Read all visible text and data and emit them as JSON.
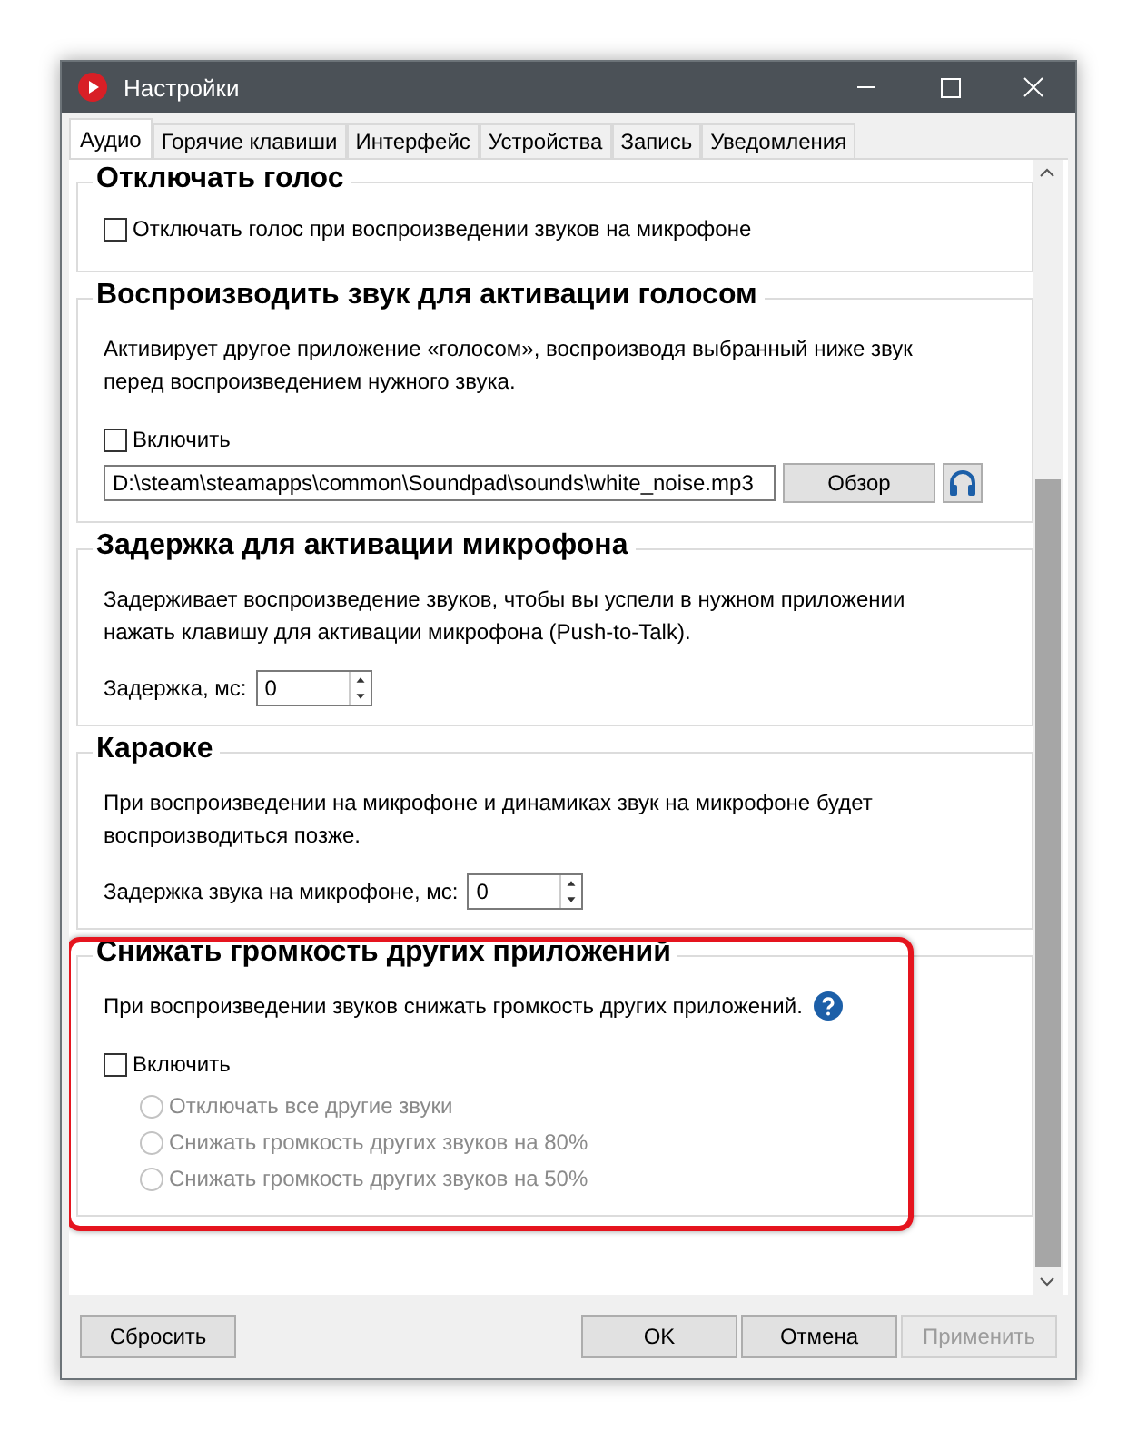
{
  "window": {
    "title": "Настройки"
  },
  "tabs": [
    {
      "label": "Аудио",
      "selected": true
    },
    {
      "label": "Горячие клавиши",
      "selected": false
    },
    {
      "label": "Интерфейс",
      "selected": false
    },
    {
      "label": "Устройства",
      "selected": false
    },
    {
      "label": "Запись",
      "selected": false
    },
    {
      "label": "Уведомления",
      "selected": false
    }
  ],
  "sections": [
    {
      "title": "Отключать голос",
      "highlighted": false,
      "items": [
        {
          "kind": "checkbox",
          "label": "Отключать голос при воспроизведении звуков на микрофоне",
          "checked": false
        }
      ]
    },
    {
      "title": "Воспроизводить звук для активации голосом",
      "highlighted": false,
      "description": "Активирует другое приложение «голосом», воспроизводя выбранный ниже звук перед воспроизведением нужного звука.",
      "items": [
        {
          "kind": "checkbox",
          "label": "Включить",
          "checked": false
        },
        {
          "kind": "file",
          "value": "D:\\steam\\steamapps\\common\\Soundpad\\sounds\\white_noise.mp3",
          "button": "Обзор"
        }
      ]
    },
    {
      "title": "Задержка для активации микрофона",
      "highlighted": false,
      "description": "Задерживает воспроизведение звуков, чтобы вы успели в нужном приложении нажать клавишу для активации микрофона (Push-to-Talk).",
      "items": [
        {
          "kind": "spin",
          "label": "Задержка, мс:",
          "value": "0"
        }
      ]
    },
    {
      "title": "Караоке",
      "highlighted": false,
      "description": "При воспроизведении на микрофоне и динамиках звук на микрофоне будет воспроизводиться позже.",
      "items": [
        {
          "kind": "spin",
          "label": "Задержка звука на микрофоне, мс:",
          "value": "0"
        }
      ]
    },
    {
      "title": "Снижать громкость других приложений",
      "highlighted": true,
      "description": "При воспроизведении звуков снижать громкость других приложений.",
      "help": true,
      "items": [
        {
          "kind": "checkbox",
          "label": "Включить",
          "checked": false
        },
        {
          "kind": "radio",
          "label": "Отключать все другие звуки",
          "selected": false,
          "disabled": true
        },
        {
          "kind": "radio",
          "label": "Снижать громкость других звуков на 80%",
          "selected": false,
          "disabled": true
        },
        {
          "kind": "radio",
          "label": "Снижать громкость других звуков на 50%",
          "selected": false,
          "disabled": true
        }
      ]
    }
  ],
  "footer": {
    "left": [
      {
        "label": "Сбросить",
        "disabled": false
      }
    ],
    "right": [
      {
        "label": "OK",
        "disabled": false
      },
      {
        "label": "Отмена",
        "disabled": false
      },
      {
        "label": "Применить",
        "disabled": true
      }
    ]
  }
}
